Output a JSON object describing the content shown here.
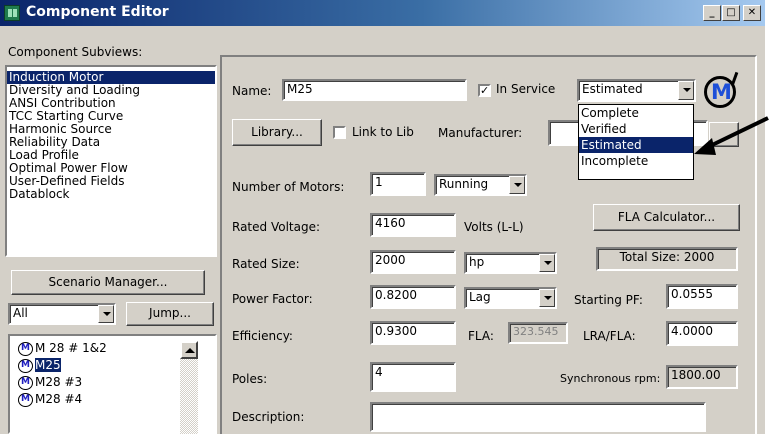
{
  "window": {
    "title": "Component Editor",
    "minimize": "_",
    "maximize": "□",
    "close": "✕"
  },
  "subviews": {
    "label": "Component Subviews:",
    "items": [
      "Induction Motor",
      "Diversity and Loading",
      "ANSI Contribution",
      "TCC Starting Curve",
      "Harmonic Source",
      "Reliability Data",
      "Load Profile",
      "Optimal Power Flow",
      "User-Defined Fields",
      "Datablock"
    ],
    "selected_index": 0
  },
  "scenario_manager": {
    "label": "Scenario Manager..."
  },
  "filter": {
    "value": "All"
  },
  "jump": {
    "label": "Jump..."
  },
  "tree": {
    "items": [
      "M 28 # 1&2",
      "M25",
      "M28 #3",
      "M28 #4"
    ],
    "icon_glyph": "M",
    "selected_index": 1
  },
  "form": {
    "name_label": "Name:",
    "name_value": "M25",
    "in_service_label": "In Service",
    "in_service_checked": true,
    "in_service_mark": "✓",
    "status_value": "Estimated",
    "status_options": [
      "Complete",
      "Verified",
      "Estimated",
      "Incomplete"
    ],
    "status_highlighted": "Estimated",
    "library_label": "Library...",
    "link_to_lib_label": "Link to Lib",
    "manufacturer_label": "Manufacturer:",
    "manufacturer_value": "",
    "num_motors_label": "Number of Motors:",
    "num_motors_value": "1",
    "running_value": "Running",
    "fla_calc_label": "FLA Calculator...",
    "rated_voltage_label": "Rated Voltage:",
    "rated_voltage_value": "4160",
    "volts_unit": "Volts (L-L)",
    "rated_size_label": "Rated Size:",
    "rated_size_value": "2000",
    "size_unit": "hp",
    "total_size": "Total Size: 2000",
    "power_factor_label": "Power Factor:",
    "power_factor_value": "0.8200",
    "pf_mode": "Lag",
    "starting_pf_label": "Starting PF:",
    "starting_pf_value": "0.0555",
    "efficiency_label": "Efficiency:",
    "efficiency_value": "0.9300",
    "fla_label": "FLA:",
    "fla_value": "323.545",
    "lra_fla_label": "LRA/FLA:",
    "lra_fla_value": "4.0000",
    "poles_label": "Poles:",
    "poles_value": "4",
    "sync_rpm_label": "Synchronous rpm:",
    "sync_rpm_value": "1800.00",
    "description_label": "Description:",
    "description_value": ""
  },
  "logo": {
    "glyph": "M"
  },
  "colors": {
    "titlebar_start": "#0a246a",
    "titlebar_end": "#a6caf0",
    "selection": "#0a246a",
    "face": "#d4d0c8"
  }
}
